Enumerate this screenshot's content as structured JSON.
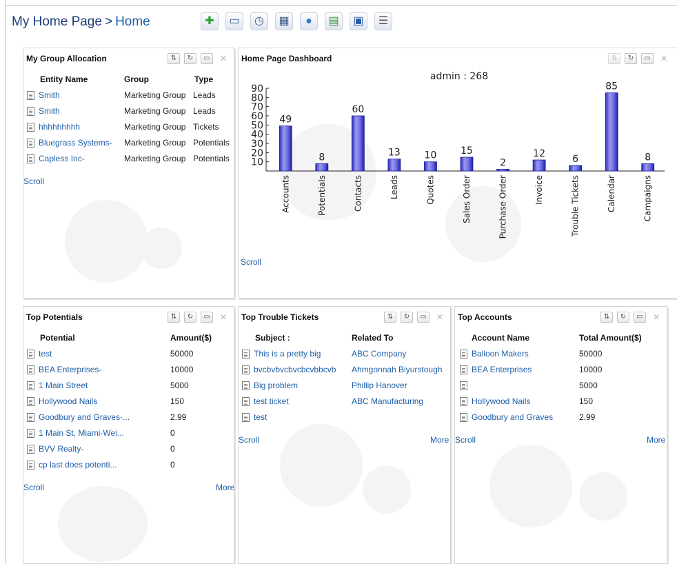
{
  "breadcrumb": {
    "root": "My Home Page",
    "separator": ">",
    "current": "Home"
  },
  "toolbar": [
    {
      "name": "add-icon",
      "glyph": "✚",
      "color": "#2e9e2e"
    },
    {
      "name": "window-icon",
      "glyph": "▭",
      "color": "#3b5a8a"
    },
    {
      "name": "clock-icon",
      "glyph": "◷",
      "color": "#3b5a8a"
    },
    {
      "name": "calculator-icon",
      "glyph": "▦",
      "color": "#3b5a8a"
    },
    {
      "name": "chat-icon",
      "glyph": "●",
      "color": "#2c7fd2"
    },
    {
      "name": "clipboard-icon",
      "glyph": "▤",
      "color": "#2e8f2e"
    },
    {
      "name": "monitor-icon",
      "glyph": "▣",
      "color": "#2c5da8"
    },
    {
      "name": "notes-icon",
      "glyph": "☰",
      "color": "#555555"
    }
  ],
  "panels": {
    "group_allocation": {
      "title": "My Group Allocation",
      "headers": [
        "Entity Name",
        "Group",
        "Type"
      ],
      "rows": [
        [
          "Smith",
          "Marketing Group",
          "Leads"
        ],
        [
          "Smith",
          "Marketing Group",
          "Leads"
        ],
        [
          "hhhhhhhhh",
          "Marketing Group",
          "Tickets"
        ],
        [
          "Bluegrass Systems-",
          "Marketing Group",
          "Potentials"
        ],
        [
          "Capless Inc-",
          "Marketing Group",
          "Potentials"
        ]
      ],
      "scroll": "Scroll"
    },
    "dashboard": {
      "title": "Home Page Dashboard",
      "scroll": "Scroll"
    },
    "top_potentials": {
      "title": "Top Potentials",
      "headers": [
        "Potential",
        "Amount($)"
      ],
      "rows": [
        [
          "test",
          "50000"
        ],
        [
          "BEA Enterprises-",
          "10000"
        ],
        [
          "1 Main Street",
          "5000"
        ],
        [
          "Hollywood Nails",
          "150"
        ],
        [
          "Goodbury and Graves-...",
          "2.99"
        ],
        [
          "1 Main St, Miami-Wei...",
          "0"
        ],
        [
          "BVV Realty-",
          "0"
        ],
        [
          "cp last does potenti...",
          "0"
        ]
      ],
      "scroll": "Scroll",
      "more": "More"
    },
    "top_tickets": {
      "title": "Top Trouble Tickets",
      "headers": [
        "Subject :",
        "Related To"
      ],
      "rows": [
        [
          "This is a pretty big",
          "ABC Company"
        ],
        [
          "bvcbvbvcbvcbcvbbcvb",
          "Ahmgonnah Biyurstough"
        ],
        [
          "Big problem",
          "Phillip Hanover"
        ],
        [
          "test ticket",
          "ABC Manufacturing"
        ],
        [
          "test",
          ""
        ]
      ],
      "scroll": "Scroll",
      "more": "More"
    },
    "top_accounts": {
      "title": "Top Accounts",
      "headers": [
        "Account Name",
        "Total Amount($)"
      ],
      "rows": [
        [
          "Balloon Makers",
          "50000"
        ],
        [
          "BEA Enterprises",
          "10000"
        ],
        [
          "",
          "5000"
        ],
        [
          "Hollywood Nails",
          "150"
        ],
        [
          "Goodbury and Graves",
          "2.99"
        ]
      ],
      "scroll": "Scroll",
      "more": "More"
    }
  },
  "chart_data": {
    "type": "bar",
    "title": "admin : 268",
    "categories": [
      "Accounts",
      "Potentials",
      "Contacts",
      "Leads",
      "Quotes",
      "Sales Order",
      "Purchase Order",
      "Invoice",
      "Trouble Tickets",
      "Calendar",
      "Campaigns"
    ],
    "values": [
      49,
      8,
      60,
      13,
      10,
      15,
      2,
      12,
      6,
      85,
      8
    ],
    "yticks": [
      10,
      20,
      30,
      40,
      50,
      60,
      70,
      80,
      90
    ],
    "ylim": [
      0,
      90
    ],
    "bar_color": "#4a4ad6",
    "grid": false,
    "legend": "none"
  }
}
